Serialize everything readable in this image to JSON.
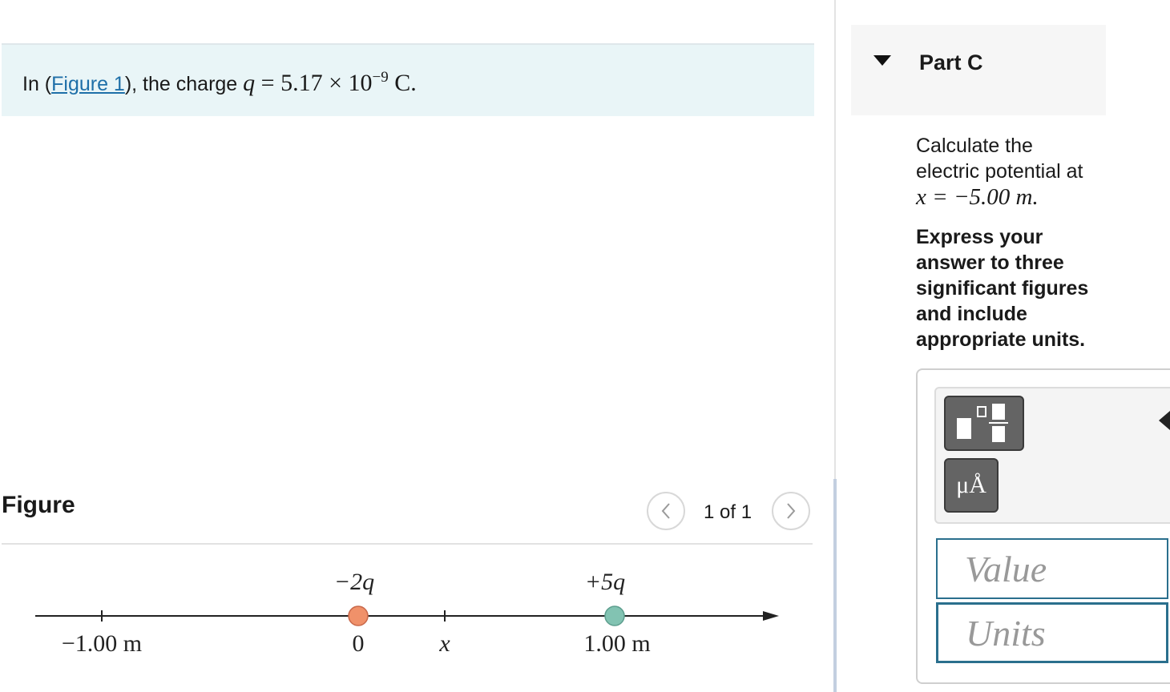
{
  "statement": {
    "prefix": "In (",
    "link": "Figure 1",
    "suffix": "), the charge ",
    "q_symbol": "q",
    "equals": " = 5.17 × 10",
    "exponent": "−9",
    "unit": " C."
  },
  "figure": {
    "title": "Figure",
    "pager": "1 of 1",
    "prev_icon": "chevron-left-icon",
    "next_icon": "chevron-right-icon",
    "charges": [
      {
        "label": "−2q",
        "position_m": 0,
        "color": "#f0916a"
      },
      {
        "label": "+5q",
        "position_m": 1.0,
        "color": "#82c3b2"
      }
    ],
    "axis_labels": {
      "left_tick": "−1.00 m",
      "origin": "0",
      "x_tick": "x",
      "right_tick": "1.00 m"
    }
  },
  "part": {
    "title": "Part C",
    "question_line1": "Calculate the",
    "question_line2": "electric potential at",
    "question_math": "x = −5.00 m.",
    "instructions": "Express your answer to three significant figures and include appropriate units."
  },
  "answer": {
    "units_button": "μÅ",
    "value_placeholder": "Value",
    "units_placeholder": "Units"
  },
  "colors": {
    "banner": "#e9f5f7",
    "link": "#1e6fa8",
    "field_border": "#2a6f8d"
  }
}
